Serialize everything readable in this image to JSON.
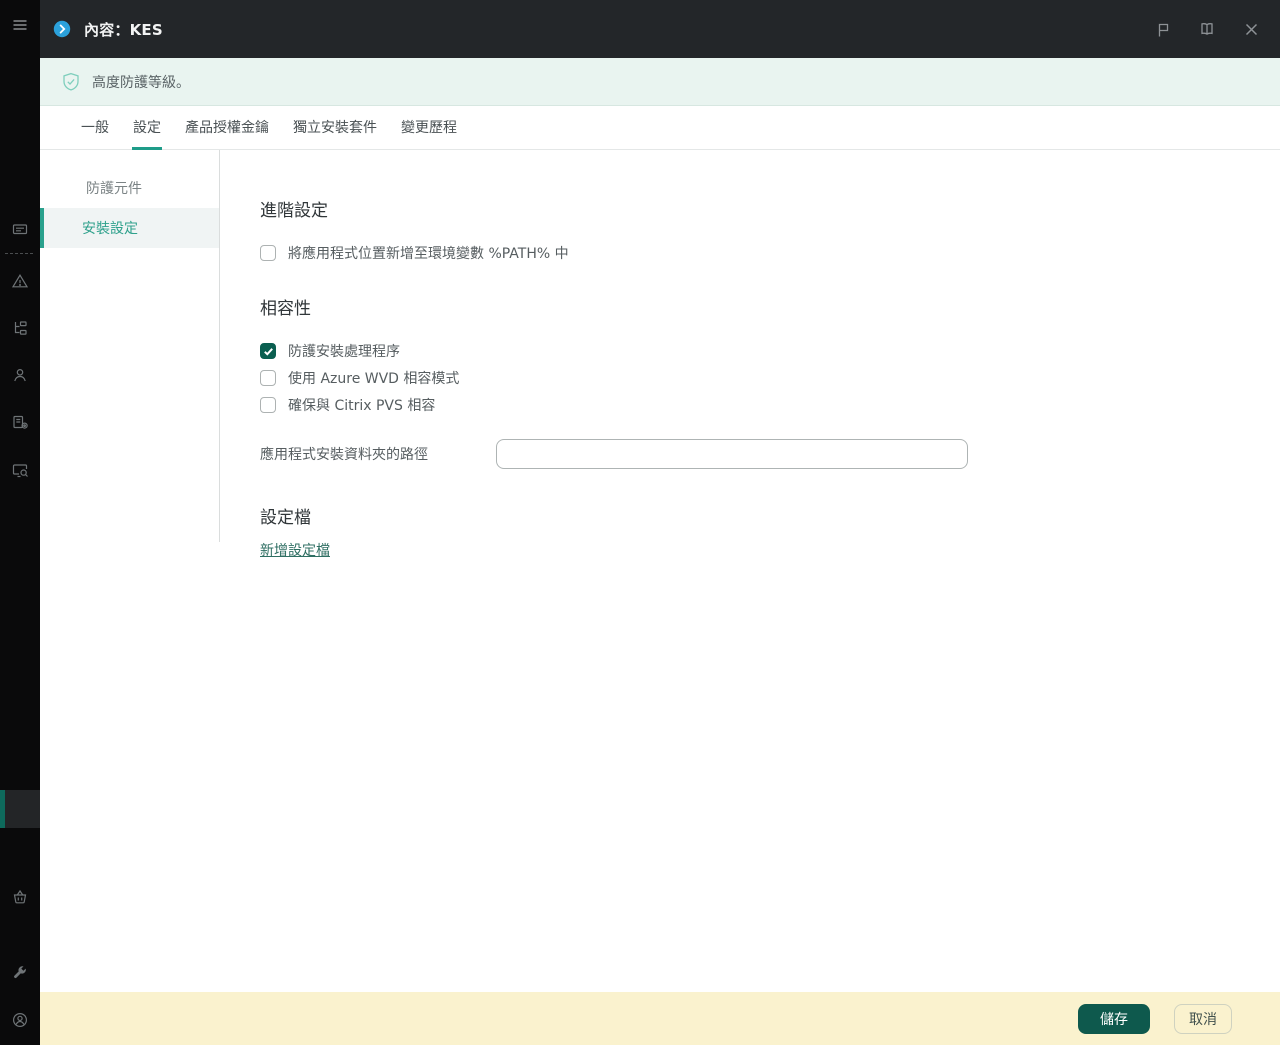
{
  "colors": {
    "accent_teal": "#1e9c89",
    "checkbox_checked": "#0a5f50",
    "save_button": "#0e594d",
    "header_bg": "#232629",
    "sidebar_bg": "#0a0a0b",
    "notice_bg": "#e9f4f0",
    "footer_bg": "#faf2ce",
    "info_icon_blue": "#2ba1db"
  },
  "sidebar": {
    "menu_icon": "hamburger-icon",
    "top_icons": [
      "monitoring-icon",
      "alerts-icon",
      "devices-icon",
      "users-icon",
      "operations-icon",
      "discovery-icon"
    ],
    "bottom_icons": [
      "marketplace-icon",
      "console-settings-icon",
      "account-icon"
    ]
  },
  "window": {
    "title": "內容：KES",
    "title_icon": "info-circle-icon",
    "action_icons": [
      "flag-icon",
      "book-icon",
      "close-icon"
    ]
  },
  "notice": {
    "icon": "shield-check-icon",
    "text": "高度防護等級。"
  },
  "tabs": [
    {
      "label": "一般",
      "active": false
    },
    {
      "label": "設定",
      "active": true
    },
    {
      "label": "產品授權金鑰",
      "active": false
    },
    {
      "label": "獨立安裝套件",
      "active": false
    },
    {
      "label": "變更歷程",
      "active": false
    }
  ],
  "subnav": [
    {
      "label": "防護元件",
      "selected": false
    },
    {
      "label": "安裝設定",
      "selected": true
    }
  ],
  "content": {
    "advanced": {
      "title": "進階設定",
      "options": [
        {
          "label": "將應用程式位置新增至環境變數 %PATH% 中",
          "checked": false
        }
      ]
    },
    "compatibility": {
      "title": "相容性",
      "options": [
        {
          "label": "防護安裝處理程序",
          "checked": true
        },
        {
          "label": "使用 Azure WVD 相容模式",
          "checked": false
        },
        {
          "label": "確保與 Citrix PVS 相容",
          "checked": false
        }
      ],
      "path_field": {
        "label": "應用程式安裝資料夾的路徑",
        "value": "",
        "placeholder": ""
      }
    },
    "config_file": {
      "title": "設定檔",
      "link": "新增設定檔"
    }
  },
  "footer": {
    "save": "儲存",
    "cancel": "取消"
  }
}
